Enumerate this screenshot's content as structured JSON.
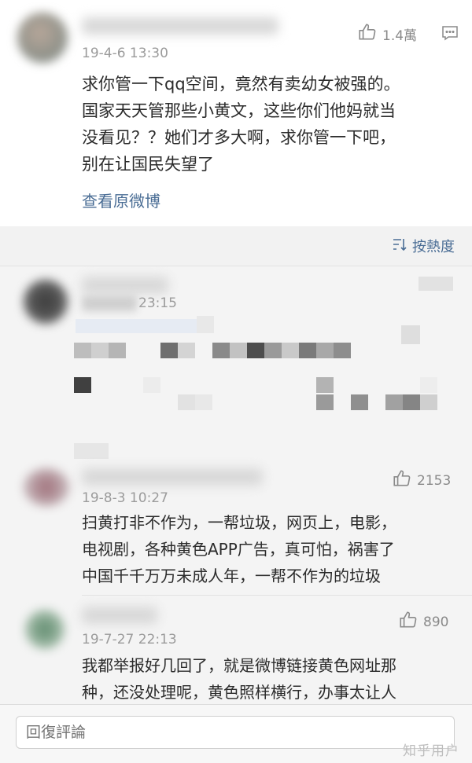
{
  "post": {
    "date": "19-4-6 13:30",
    "like_count": "1.4萬",
    "text": "求你管一下qq空间，竟然有卖幼女被强的。\n国家天天管那些小黄文，这些你们他妈就当\n没看见？？她们才多大啊，求你管一下吧，\n别在让国民失望了",
    "view_original": "查看原微博"
  },
  "sort": {
    "label": "按熱度"
  },
  "comments": [
    {
      "date": "19-8-3 10:27",
      "likes": "2153",
      "text": "扫黄打非不作为，一帮垃圾，网页上，电影，\n电视剧，各种黄色APP广告，真可怕，祸害了\n中国千千万万未成人年，一帮不作为的垃圾"
    },
    {
      "date": "19-7-27 22:13",
      "likes": "890",
      "text": "我都举报好几回了，就是微博链接黄色网址那\n种，还没处理呢，黄色照样横行，办事太让人"
    }
  ],
  "pixelated_comment": {
    "time": "23:15"
  },
  "reply": {
    "placeholder": "回復評論"
  },
  "watermark": "知乎用户",
  "colors": {
    "link": "#4a6d95",
    "meta": "#9b9b9b",
    "background": "#f2f2f2"
  },
  "icons": [
    "thumbs-up-icon",
    "comment-icon",
    "sort-icon"
  ]
}
